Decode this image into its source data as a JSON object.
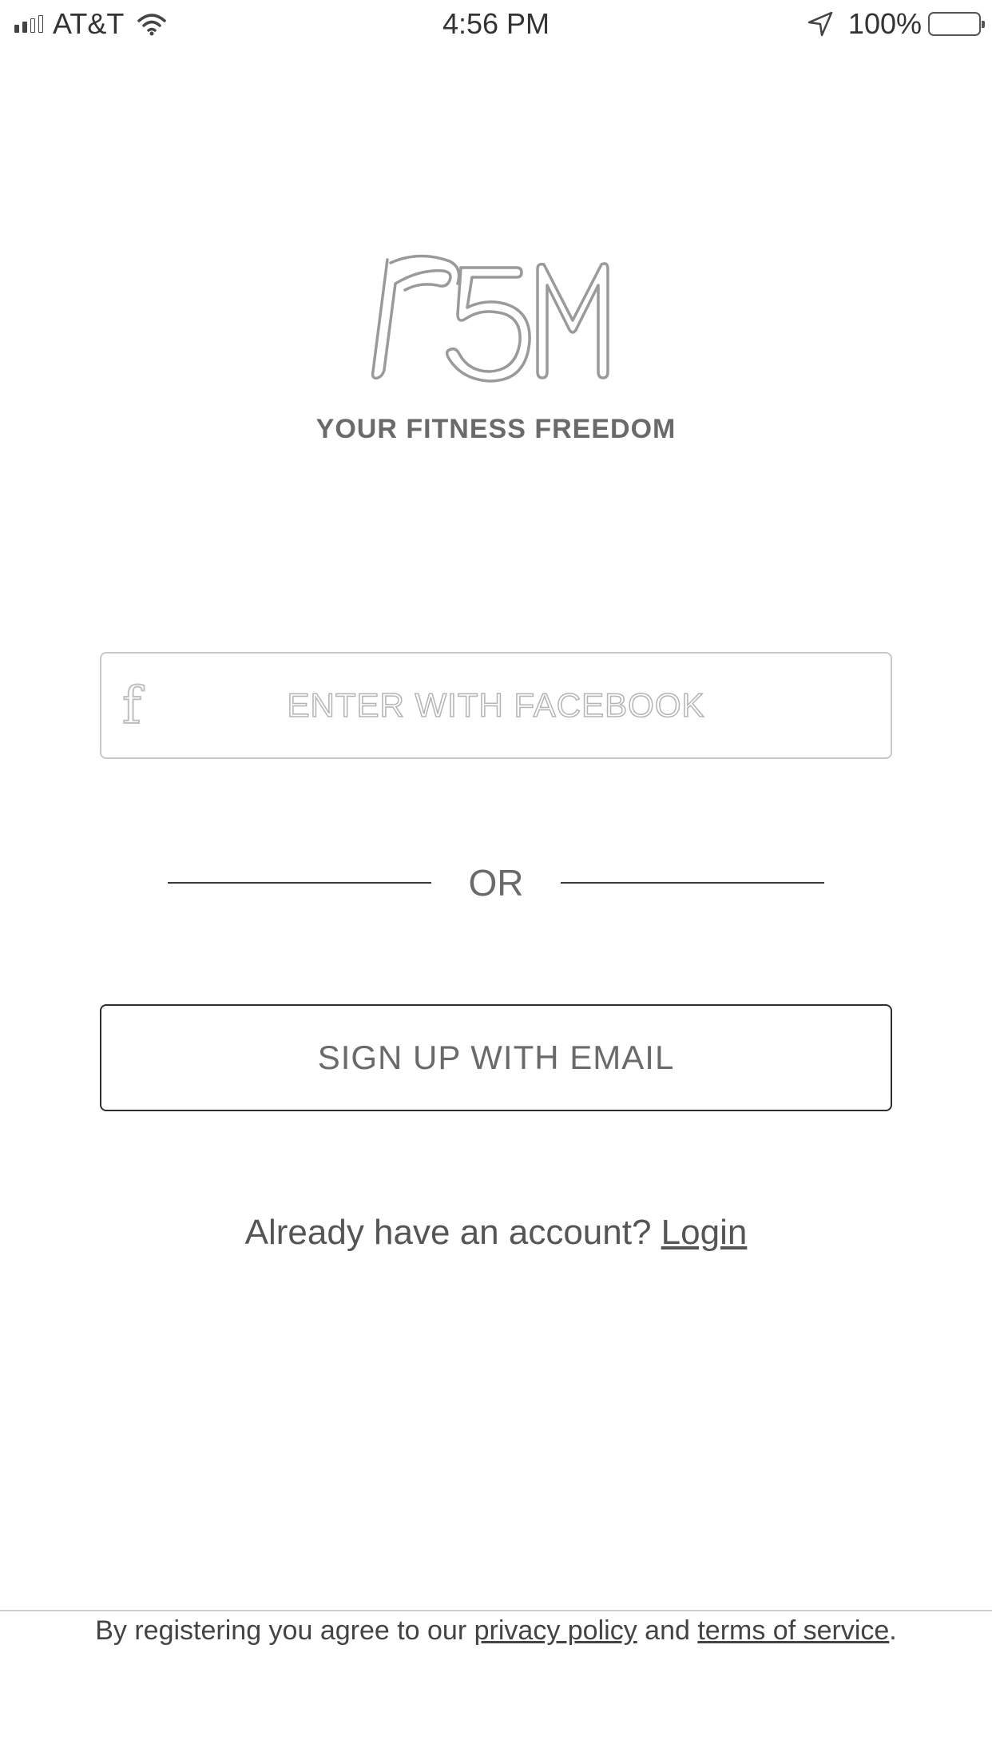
{
  "status_bar": {
    "carrier": "AT&T",
    "time": "4:56 PM",
    "battery": "100%",
    "icons": [
      "signal-icon",
      "wifi-icon",
      "location-arrow-icon",
      "battery-icon"
    ]
  },
  "brand": {
    "logo_icon": "p5m-logo-icon",
    "logo_text": "P5M",
    "tagline": "YOUR FITNESS FREEDOM"
  },
  "facebook_button": {
    "icon": "facebook-f-icon",
    "label": "ENTER WITH FACEBOOK"
  },
  "divider": {
    "label": "OR"
  },
  "email_button": {
    "label": "SIGN UP WITH EMAIL"
  },
  "login": {
    "prompt": "Already have an account?",
    "link": "Login"
  },
  "terms": {
    "prefix": "By registering you agree to our",
    "privacy_link": "privacy policy",
    "conjunction": "and",
    "terms_link": "terms of service",
    "suffix": "."
  }
}
